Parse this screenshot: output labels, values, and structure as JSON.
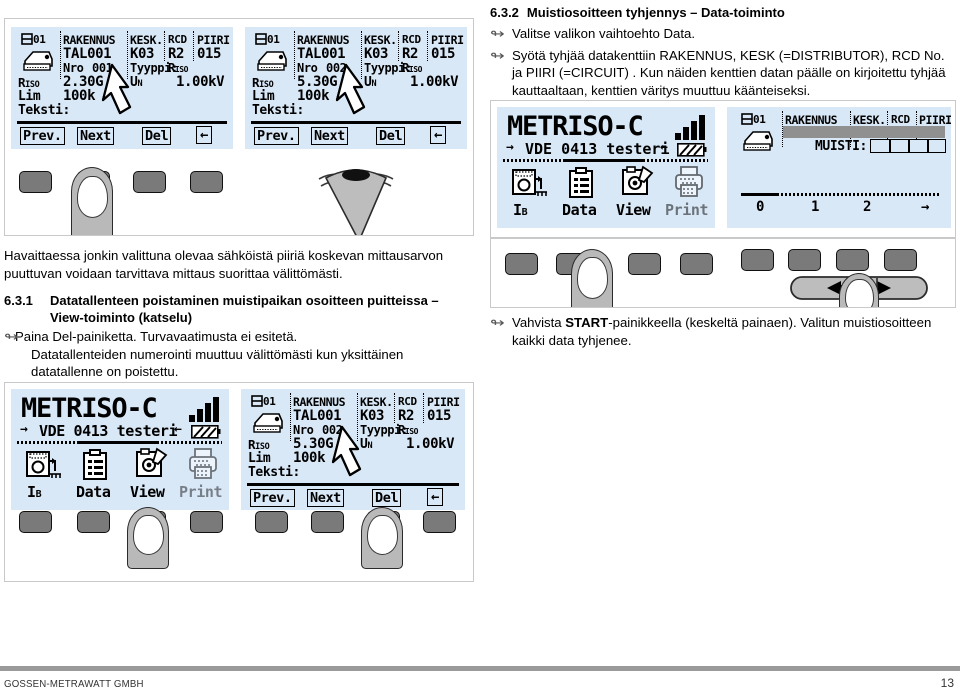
{
  "document": {
    "footer_company": "GOSSEN-METRAWATT GMBH",
    "footer_page": "13"
  },
  "sections": {
    "s632": {
      "number": "6.3.2",
      "title": "Muistiosoitteen tyhjennys – Data-toiminto",
      "bullet_glyph": "↬",
      "bullets": [
        "Valitse valikon vaihtoehto Data.",
        "Syötä tyhjää datakenttiin RAKENNUS, KESK (=DISTRIBUTOR), RCD No. ja PIIRI (=CIRCUIT) . Kun näiden kenttien datan päälle on kirjoitettu tyhjää kauttaaltaan, kenttien väritys muuttuu käänteiseksi."
      ],
      "confirm_prefix": "Vahvista ",
      "confirm_bold": "START",
      "confirm_suffix": "-painikkeella (keskeltä painaen). Valitun muistiosoitteen kaikki data tyhjenee."
    },
    "intro": {
      "paragraph": "Havaittaessa jonkin valittuna olevaa sähköistä piiriä koskevan mittausarvon puuttuvan voidaan tarvittava mittaus suorittaa välittömästi."
    },
    "s631": {
      "number": "6.3.1",
      "title_line1": "Datatallenteen poistaminen muistipaikan osoitteen puitteissa –",
      "title_line2": "View-toiminto (katselu)",
      "bullet_glyph": "↬",
      "bullet_line1": "Paina Del-painiketta. Turvavaatimusta ei esitetä.",
      "bullet_line2": "Datatallenteiden numerointi muuttuu välittömästi kun yksittäinen datatallenne on poistettu."
    }
  },
  "lcd_data_record": {
    "header_cols": [
      "RAKENNUS",
      "KESK.",
      "RCD",
      "PIIRI"
    ],
    "memory_index": "01",
    "row_values": [
      "TAL001",
      "K03",
      "R2",
      "015"
    ],
    "nro_label": "Nro",
    "nro_value_a": "001",
    "nro_value_b": "002",
    "tyyppi_label": "Tyyppi:",
    "tyyppi_value": "Riso",
    "riso_label": "Riso",
    "riso_value_a": "2.30G",
    "riso_value_b": "5.30G",
    "un_label": "UN",
    "un_value": "1.00kV",
    "lim_label": "Lim",
    "lim_value": "100k",
    "teksti_label": "Teksti:",
    "softkeys": [
      "Prev.",
      "Next",
      "Del",
      "←"
    ]
  },
  "lcd_main_menu": {
    "brand": "METRISO-C",
    "subtitle": "VDE 0413 testeri",
    "arrow_left": "→",
    "arrow_right": "←",
    "icons": [
      {
        "name": "ib-icon",
        "label": "IB"
      },
      {
        "name": "data-icon",
        "label": "Data"
      },
      {
        "name": "view-icon",
        "label": "View"
      },
      {
        "name": "print-icon",
        "label": "Print"
      }
    ]
  },
  "lcd_memory": {
    "header_cols": [
      "RAKENNUS",
      "KESK.",
      "RCD",
      "PIIRI"
    ],
    "memory_index": "01",
    "muisti_label": "MUISTI:",
    "scale_labels": [
      "0",
      "1",
      "2",
      "→"
    ]
  },
  "colors": {
    "lcd_background": "#d9e8f7",
    "key_gray": "#7a7a7a",
    "finger_gray": "#b9b9b9",
    "footer_rule": "#9a9a9a",
    "frame_border": "#c9c9c9",
    "inverse_field": "#909090"
  }
}
